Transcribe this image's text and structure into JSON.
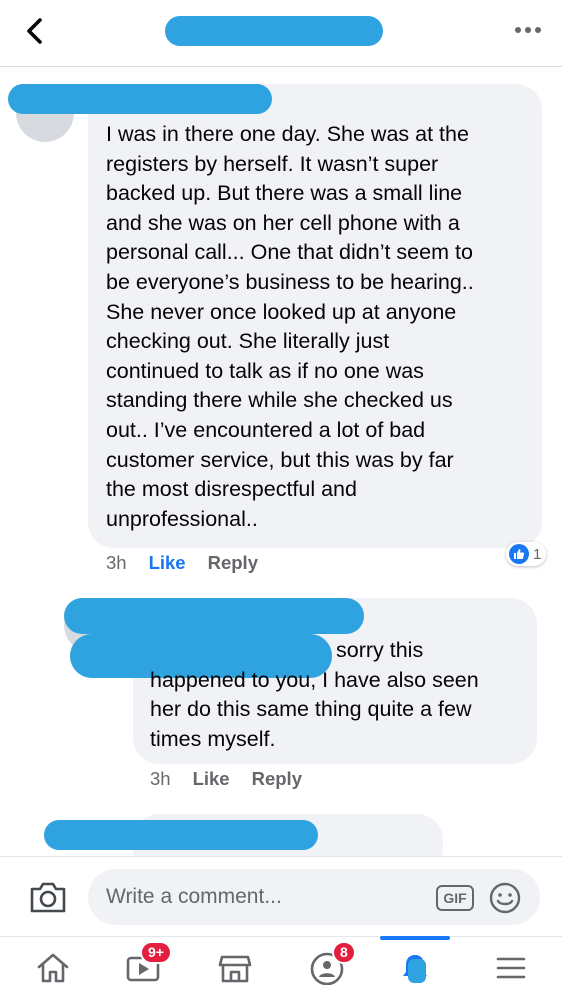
{
  "header": {
    "back_icon": "chevron-left-icon",
    "more_icon": "more-dots-icon"
  },
  "comments": [
    {
      "text": "I was in there one day. She was at the\nregisters by herself. It wasn’t super\nbacked up. But there was a small line\nand she was on her cell phone with a\npersonal call... One that didn’t seem to\nbe everyone’s business to be hearing..\nShe never once looked up at anyone\nchecking out. She literally just\ncontinued to talk as if no one was\nstanding there while she checked us\nout.. I’ve encountered a lot of bad\ncustomer service, but this was by far\nthe most disrespectful and\nunprofessional..",
      "time": "3h",
      "like_label": "Like",
      "reply_label": "Reply",
      "reaction_count": "1"
    },
    {
      "text": "sorry this\nhappened to you, I have also seen\nher do this same thing quite a few\ntimes myself.",
      "time": "3h",
      "like_label": "Like",
      "reply_label": "Reply"
    }
  ],
  "composer": {
    "placeholder": "Write a comment...",
    "gif_label": "GIF",
    "camera_icon": "camera-icon",
    "emoji_icon": "emoji-icon"
  },
  "bottom_nav": {
    "items": [
      {
        "icon": "home-icon"
      },
      {
        "icon": "video-icon",
        "badge": "9+"
      },
      {
        "icon": "marketplace-icon"
      },
      {
        "icon": "groups-icon",
        "badge": "8"
      },
      {
        "icon": "notifications-icon",
        "active": true
      },
      {
        "icon": "menu-icon"
      }
    ]
  },
  "colors": {
    "accent": "#1877f2",
    "bubble": "#f0f2f5",
    "redaction": "#2fa3e0",
    "badge": "#e41e3f"
  }
}
